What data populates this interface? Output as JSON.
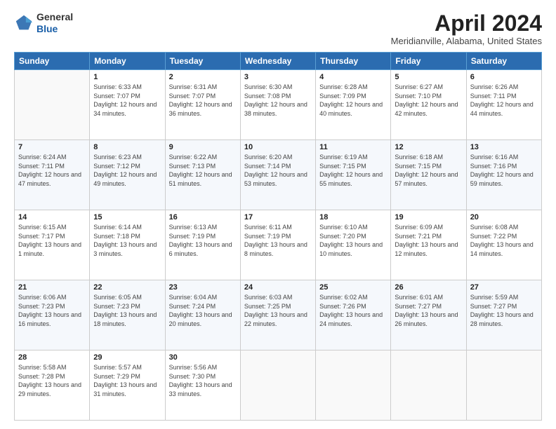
{
  "logo": {
    "general": "General",
    "blue": "Blue"
  },
  "header": {
    "title": "April 2024",
    "location": "Meridianville, Alabama, United States"
  },
  "weekdays": [
    "Sunday",
    "Monday",
    "Tuesday",
    "Wednesday",
    "Thursday",
    "Friday",
    "Saturday"
  ],
  "weeks": [
    [
      {
        "day": "",
        "sunrise": "",
        "sunset": "",
        "daylight": ""
      },
      {
        "day": "1",
        "sunrise": "Sunrise: 6:33 AM",
        "sunset": "Sunset: 7:07 PM",
        "daylight": "Daylight: 12 hours and 34 minutes."
      },
      {
        "day": "2",
        "sunrise": "Sunrise: 6:31 AM",
        "sunset": "Sunset: 7:07 PM",
        "daylight": "Daylight: 12 hours and 36 minutes."
      },
      {
        "day": "3",
        "sunrise": "Sunrise: 6:30 AM",
        "sunset": "Sunset: 7:08 PM",
        "daylight": "Daylight: 12 hours and 38 minutes."
      },
      {
        "day": "4",
        "sunrise": "Sunrise: 6:28 AM",
        "sunset": "Sunset: 7:09 PM",
        "daylight": "Daylight: 12 hours and 40 minutes."
      },
      {
        "day": "5",
        "sunrise": "Sunrise: 6:27 AM",
        "sunset": "Sunset: 7:10 PM",
        "daylight": "Daylight: 12 hours and 42 minutes."
      },
      {
        "day": "6",
        "sunrise": "Sunrise: 6:26 AM",
        "sunset": "Sunset: 7:11 PM",
        "daylight": "Daylight: 12 hours and 44 minutes."
      }
    ],
    [
      {
        "day": "7",
        "sunrise": "Sunrise: 6:24 AM",
        "sunset": "Sunset: 7:11 PM",
        "daylight": "Daylight: 12 hours and 47 minutes."
      },
      {
        "day": "8",
        "sunrise": "Sunrise: 6:23 AM",
        "sunset": "Sunset: 7:12 PM",
        "daylight": "Daylight: 12 hours and 49 minutes."
      },
      {
        "day": "9",
        "sunrise": "Sunrise: 6:22 AM",
        "sunset": "Sunset: 7:13 PM",
        "daylight": "Daylight: 12 hours and 51 minutes."
      },
      {
        "day": "10",
        "sunrise": "Sunrise: 6:20 AM",
        "sunset": "Sunset: 7:14 PM",
        "daylight": "Daylight: 12 hours and 53 minutes."
      },
      {
        "day": "11",
        "sunrise": "Sunrise: 6:19 AM",
        "sunset": "Sunset: 7:15 PM",
        "daylight": "Daylight: 12 hours and 55 minutes."
      },
      {
        "day": "12",
        "sunrise": "Sunrise: 6:18 AM",
        "sunset": "Sunset: 7:15 PM",
        "daylight": "Daylight: 12 hours and 57 minutes."
      },
      {
        "day": "13",
        "sunrise": "Sunrise: 6:16 AM",
        "sunset": "Sunset: 7:16 PM",
        "daylight": "Daylight: 12 hours and 59 minutes."
      }
    ],
    [
      {
        "day": "14",
        "sunrise": "Sunrise: 6:15 AM",
        "sunset": "Sunset: 7:17 PM",
        "daylight": "Daylight: 13 hours and 1 minute."
      },
      {
        "day": "15",
        "sunrise": "Sunrise: 6:14 AM",
        "sunset": "Sunset: 7:18 PM",
        "daylight": "Daylight: 13 hours and 3 minutes."
      },
      {
        "day": "16",
        "sunrise": "Sunrise: 6:13 AM",
        "sunset": "Sunset: 7:19 PM",
        "daylight": "Daylight: 13 hours and 6 minutes."
      },
      {
        "day": "17",
        "sunrise": "Sunrise: 6:11 AM",
        "sunset": "Sunset: 7:19 PM",
        "daylight": "Daylight: 13 hours and 8 minutes."
      },
      {
        "day": "18",
        "sunrise": "Sunrise: 6:10 AM",
        "sunset": "Sunset: 7:20 PM",
        "daylight": "Daylight: 13 hours and 10 minutes."
      },
      {
        "day": "19",
        "sunrise": "Sunrise: 6:09 AM",
        "sunset": "Sunset: 7:21 PM",
        "daylight": "Daylight: 13 hours and 12 minutes."
      },
      {
        "day": "20",
        "sunrise": "Sunrise: 6:08 AM",
        "sunset": "Sunset: 7:22 PM",
        "daylight": "Daylight: 13 hours and 14 minutes."
      }
    ],
    [
      {
        "day": "21",
        "sunrise": "Sunrise: 6:06 AM",
        "sunset": "Sunset: 7:23 PM",
        "daylight": "Daylight: 13 hours and 16 minutes."
      },
      {
        "day": "22",
        "sunrise": "Sunrise: 6:05 AM",
        "sunset": "Sunset: 7:23 PM",
        "daylight": "Daylight: 13 hours and 18 minutes."
      },
      {
        "day": "23",
        "sunrise": "Sunrise: 6:04 AM",
        "sunset": "Sunset: 7:24 PM",
        "daylight": "Daylight: 13 hours and 20 minutes."
      },
      {
        "day": "24",
        "sunrise": "Sunrise: 6:03 AM",
        "sunset": "Sunset: 7:25 PM",
        "daylight": "Daylight: 13 hours and 22 minutes."
      },
      {
        "day": "25",
        "sunrise": "Sunrise: 6:02 AM",
        "sunset": "Sunset: 7:26 PM",
        "daylight": "Daylight: 13 hours and 24 minutes."
      },
      {
        "day": "26",
        "sunrise": "Sunrise: 6:01 AM",
        "sunset": "Sunset: 7:27 PM",
        "daylight": "Daylight: 13 hours and 26 minutes."
      },
      {
        "day": "27",
        "sunrise": "Sunrise: 5:59 AM",
        "sunset": "Sunset: 7:27 PM",
        "daylight": "Daylight: 13 hours and 28 minutes."
      }
    ],
    [
      {
        "day": "28",
        "sunrise": "Sunrise: 5:58 AM",
        "sunset": "Sunset: 7:28 PM",
        "daylight": "Daylight: 13 hours and 29 minutes."
      },
      {
        "day": "29",
        "sunrise": "Sunrise: 5:57 AM",
        "sunset": "Sunset: 7:29 PM",
        "daylight": "Daylight: 13 hours and 31 minutes."
      },
      {
        "day": "30",
        "sunrise": "Sunrise: 5:56 AM",
        "sunset": "Sunset: 7:30 PM",
        "daylight": "Daylight: 13 hours and 33 minutes."
      },
      {
        "day": "",
        "sunrise": "",
        "sunset": "",
        "daylight": ""
      },
      {
        "day": "",
        "sunrise": "",
        "sunset": "",
        "daylight": ""
      },
      {
        "day": "",
        "sunrise": "",
        "sunset": "",
        "daylight": ""
      },
      {
        "day": "",
        "sunrise": "",
        "sunset": "",
        "daylight": ""
      }
    ]
  ]
}
